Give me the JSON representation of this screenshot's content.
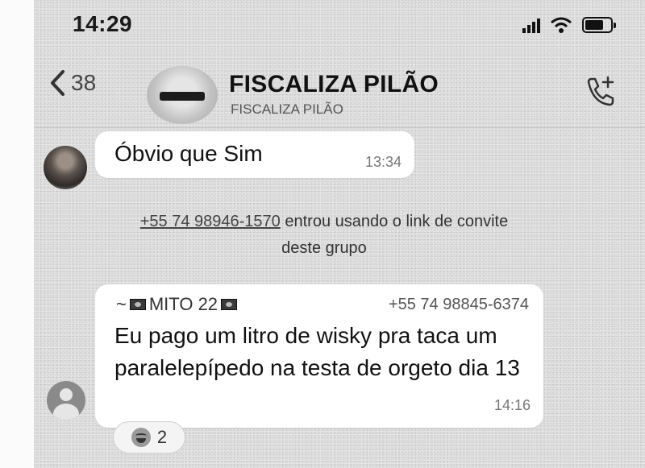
{
  "status_bar": {
    "time": "14:29"
  },
  "header": {
    "back_count": "38",
    "group_title": "FISCALIZA PILÃO",
    "group_subtitle": "FISCALIZA PILÃO"
  },
  "messages": [
    {
      "text": "Óbvio que Sim",
      "time": "13:34"
    },
    {
      "sender": "~ 🇲🇷MITO 22🇲🇷",
      "sender_name": "MITO 22",
      "sender_prefix": "~",
      "phone": "+55 74 98845-6374",
      "text": "Eu pago um litro de wisky pra taca um paralelepípedo na testa de orgeto dia 13",
      "time": "14:16"
    }
  ],
  "system_message": {
    "phone": "+55 74 98946-1570",
    "text": " entrou usando o link de convite deste grupo"
  },
  "reaction": {
    "emoji": "laughing-emoji-icon",
    "count": "2"
  },
  "colors": {
    "chat_background": "#dcdcdc",
    "bubble": "#ffffff"
  }
}
